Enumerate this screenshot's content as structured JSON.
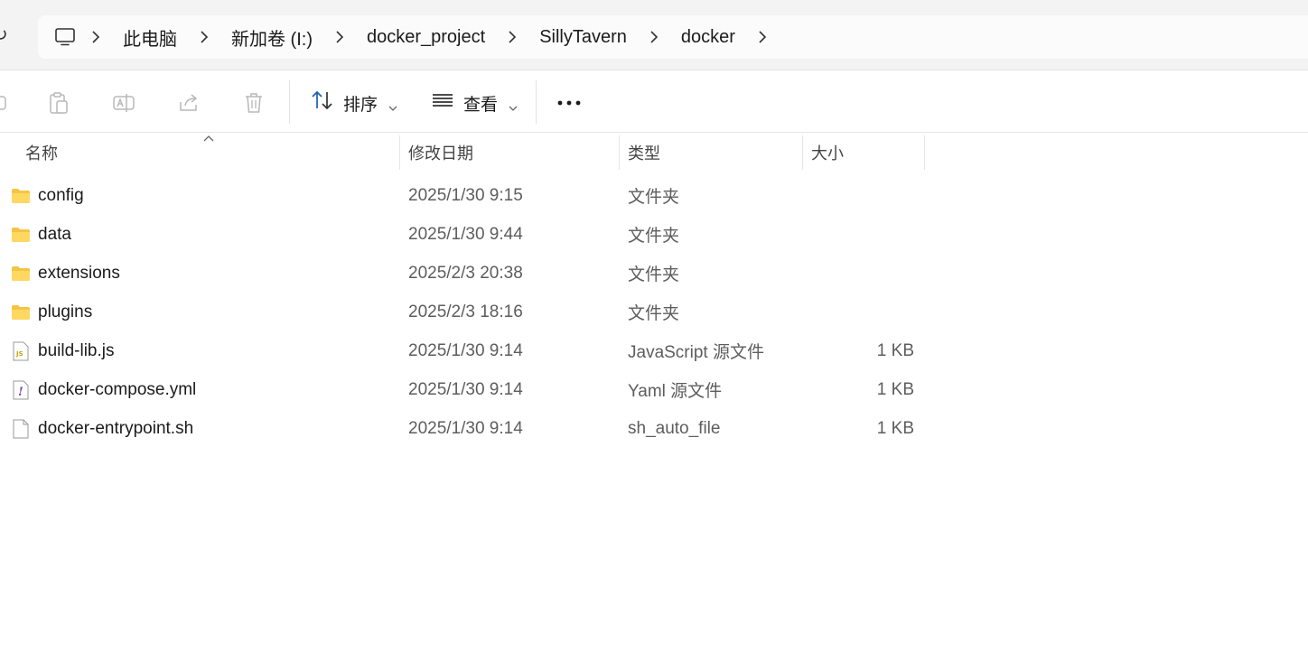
{
  "breadcrumb": {
    "root_icon": "computer-icon",
    "items": [
      "此电脑",
      "新加卷 (I:)",
      "docker_project",
      "SillyTavern",
      "docker"
    ]
  },
  "toolbar": {
    "sort_label": "排序",
    "view_label": "查看",
    "more_label": "..."
  },
  "columns": {
    "name": "名称",
    "date": "修改日期",
    "type": "类型",
    "size": "大小"
  },
  "files": [
    {
      "name": "config",
      "date": "2025/1/30 9:15",
      "type": "文件夹",
      "size": "",
      "icon": "folder-icon"
    },
    {
      "name": "data",
      "date": "2025/1/30 9:44",
      "type": "文件夹",
      "size": "",
      "icon": "folder-icon"
    },
    {
      "name": "extensions",
      "date": "2025/2/3 20:38",
      "type": "文件夹",
      "size": "",
      "icon": "folder-icon"
    },
    {
      "name": "plugins",
      "date": "2025/2/3 18:16",
      "type": "文件夹",
      "size": "",
      "icon": "folder-icon"
    },
    {
      "name": "build-lib.js",
      "date": "2025/1/30 9:14",
      "type": "JavaScript 源文件",
      "size": "1 KB",
      "icon": "js-file-icon"
    },
    {
      "name": "docker-compose.yml",
      "date": "2025/1/30 9:14",
      "type": "Yaml 源文件",
      "size": "1 KB",
      "icon": "yaml-file-icon"
    },
    {
      "name": "docker-entrypoint.sh",
      "date": "2025/1/30 9:14",
      "type": "sh_auto_file",
      "size": "1 KB",
      "icon": "file-icon"
    }
  ],
  "colors": {
    "folder": "#f5c443",
    "accent": "#005fb8"
  }
}
